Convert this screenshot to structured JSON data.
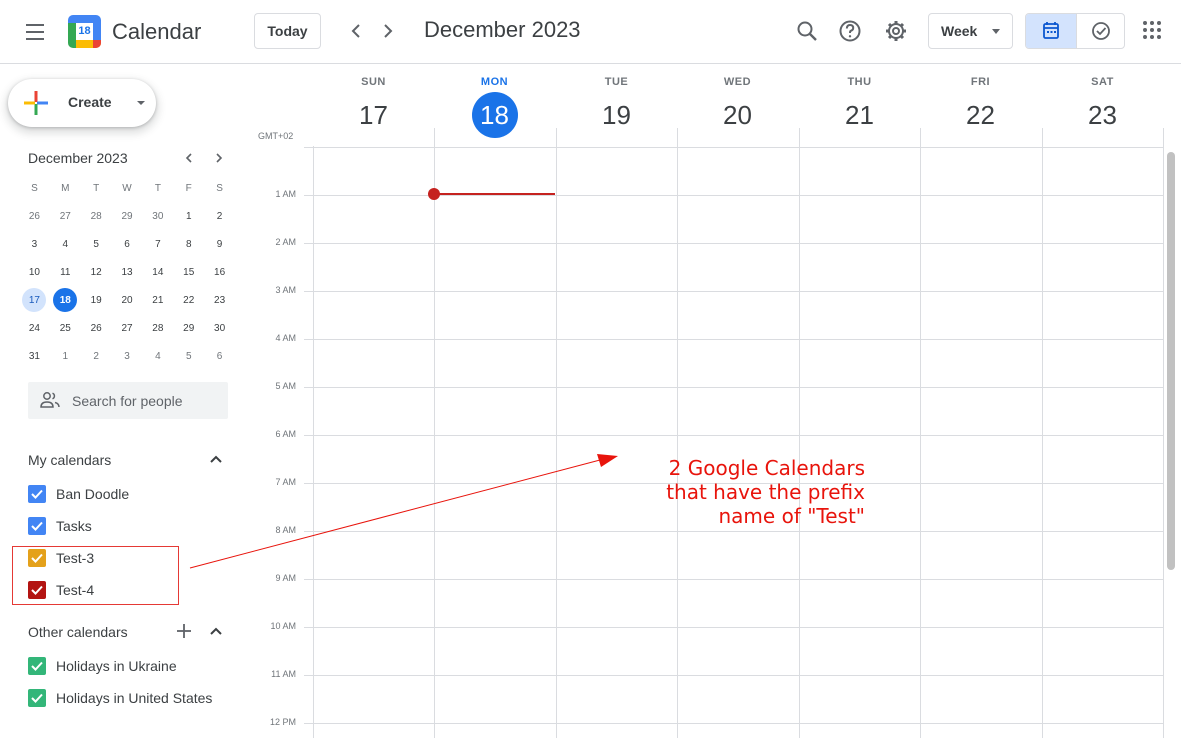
{
  "header": {
    "app_title": "Calendar",
    "logo_day": "18",
    "today_label": "Today",
    "month_title": "December 2023",
    "view_label": "Week",
    "icons": [
      "menu-icon",
      "search-icon",
      "help-icon",
      "settings-icon",
      "calendar-view-icon",
      "tasks-icon",
      "apps-icon"
    ]
  },
  "sidebar": {
    "create_label": "Create",
    "mini_calendar": {
      "title": "December 2023",
      "weekdays": [
        "S",
        "M",
        "T",
        "W",
        "T",
        "F",
        "S"
      ],
      "weeks": [
        [
          "26",
          "27",
          "28",
          "29",
          "30",
          "1",
          "2"
        ],
        [
          "3",
          "4",
          "5",
          "6",
          "7",
          "8",
          "9"
        ],
        [
          "10",
          "11",
          "12",
          "13",
          "14",
          "15",
          "16"
        ],
        [
          "17",
          "18",
          "19",
          "20",
          "21",
          "22",
          "23"
        ],
        [
          "24",
          "25",
          "26",
          "27",
          "28",
          "29",
          "30"
        ],
        [
          "31",
          "1",
          "2",
          "3",
          "4",
          "5",
          "6"
        ]
      ],
      "selected_day": "17",
      "today_day": "18"
    },
    "search_people_placeholder": "Search for people",
    "my_calendars": {
      "title": "My calendars",
      "items": [
        {
          "name": "Ban Doodle",
          "color": "#4285f4"
        },
        {
          "name": "Tasks",
          "color": "#4285f4"
        },
        {
          "name": "Test-3",
          "color": "#e4a11b"
        },
        {
          "name": "Test-4",
          "color": "#b31412"
        }
      ]
    },
    "other_calendars": {
      "title": "Other calendars",
      "items": [
        {
          "name": "Holidays in Ukraine",
          "color": "#33b679"
        },
        {
          "name": "Holidays in United States",
          "color": "#33b679"
        }
      ]
    }
  },
  "week": {
    "timezone": "GMT+02",
    "days": [
      {
        "name": "SUN",
        "num": "17"
      },
      {
        "name": "MON",
        "num": "18",
        "today": true
      },
      {
        "name": "TUE",
        "num": "19"
      },
      {
        "name": "WED",
        "num": "20"
      },
      {
        "name": "THU",
        "num": "21"
      },
      {
        "name": "FRI",
        "num": "22"
      },
      {
        "name": "SAT",
        "num": "23"
      }
    ],
    "hours": [
      "1 AM",
      "2 AM",
      "3 AM",
      "4 AM",
      "5 AM",
      "6 AM",
      "7 AM",
      "8 AM",
      "9 AM",
      "10 AM",
      "11 AM",
      "12 PM"
    ]
  },
  "annotation": {
    "lines": [
      "2 Google Calendars",
      "that have the prefix",
      "name of \"Test\""
    ],
    "color": "#e8140c"
  }
}
